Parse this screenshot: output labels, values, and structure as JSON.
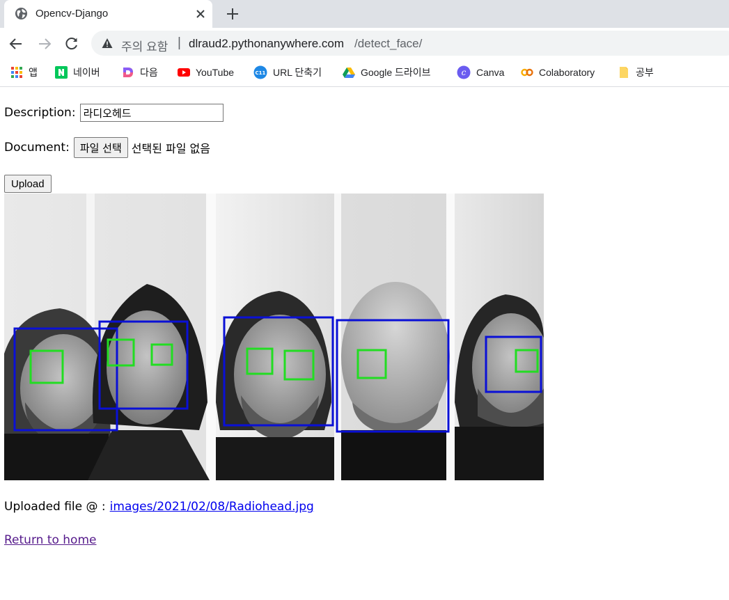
{
  "browser": {
    "tab": {
      "title": "Opencv-Django",
      "icon": "globe-icon"
    },
    "address": {
      "warning": "주의 요함",
      "separator": "|",
      "host": "dlraud2.pythonanywhere.com",
      "path": "/detect_face/"
    },
    "bookmarks": [
      {
        "label": "앱",
        "icon": "apps-grid-icon"
      },
      {
        "label": "네이버",
        "icon": "naver-icon"
      },
      {
        "label": "다음",
        "icon": "daum-icon"
      },
      {
        "label": "YouTube",
        "icon": "youtube-icon"
      },
      {
        "label": "URL 단축기",
        "icon": "url-shortener-icon"
      },
      {
        "label": "Google 드라이브",
        "icon": "google-drive-icon"
      },
      {
        "label": "Canva",
        "icon": "canva-icon"
      },
      {
        "label": "Colaboratory",
        "icon": "colab-icon"
      },
      {
        "label": "공부",
        "icon": "folder-icon"
      }
    ]
  },
  "form": {
    "description_label": "Description:",
    "description_value": "라디오헤드",
    "document_label": "Document:",
    "file_button": "파일 선택",
    "file_status": "선택된 파일 없음",
    "upload_button": "Upload"
  },
  "result": {
    "uploaded_prefix": "Uploaded file @ :",
    "file_link": "images/2021/02/08/Radiohead.jpg",
    "home_link": "Return to home"
  },
  "colors": {
    "face_box": "#0a10d6",
    "eye_box": "#22dd22",
    "link": "#0000ee",
    "visited_link": "#551a8b"
  }
}
